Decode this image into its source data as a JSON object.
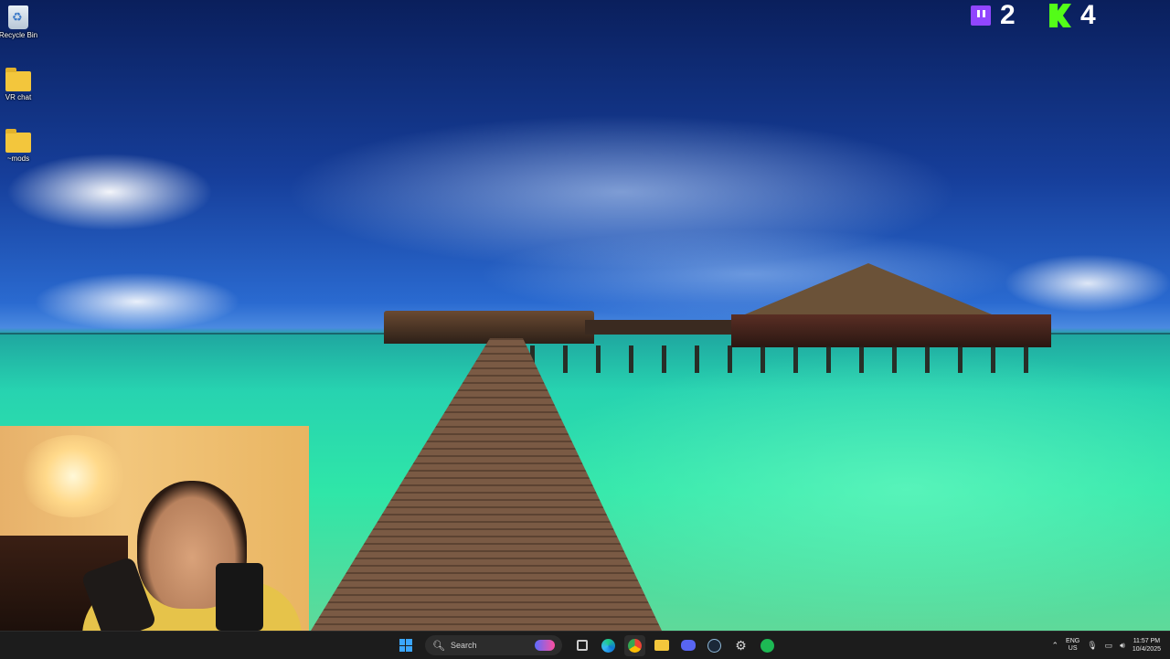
{
  "desktop": {
    "icons": [
      {
        "label": "Recycle Bin",
        "icon": "recycle-bin-icon"
      },
      {
        "label": "VR chat",
        "icon": "folder-icon"
      },
      {
        "label": "~mods",
        "icon": "folder-icon"
      }
    ]
  },
  "overlay": {
    "twitch_count": "2",
    "kick_count": "4"
  },
  "taskbar": {
    "search_label": "Search",
    "pinned_apps": [
      "start-icon",
      "search-icon",
      "media-icon",
      "task-view-icon",
      "edge-icon",
      "chrome-icon",
      "file-explorer-icon",
      "discord-icon",
      "steam-icon",
      "settings-icon",
      "spotify-icon"
    ],
    "tray": {
      "lang_top": "ENG",
      "lang_bottom": "US",
      "time": "11:57 PM",
      "date": "10/4/2025"
    }
  },
  "colors": {
    "twitch": "#9146ff",
    "kick": "#53fc18",
    "taskbar_bg": "#1c1c1c"
  }
}
